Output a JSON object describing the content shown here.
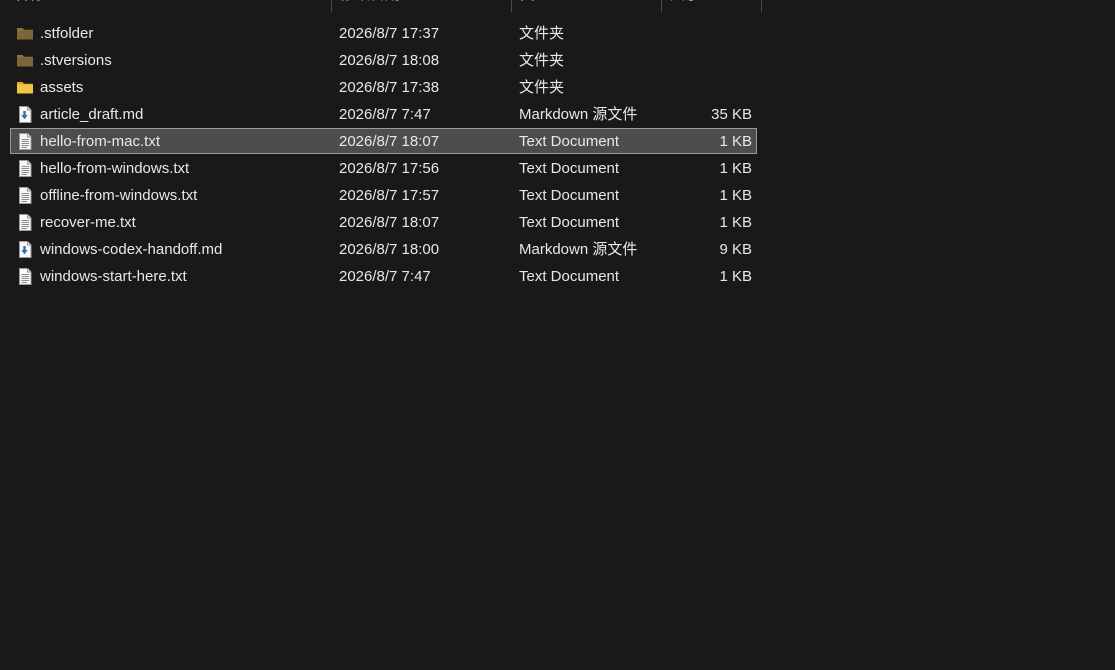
{
  "header": {
    "name_label": "名称",
    "date_label": "修改日期",
    "type_label": "类型",
    "size_label": "大小"
  },
  "files": [
    {
      "name": ".stfolder",
      "date": "2026/8/7 17:37",
      "type": "文件夹",
      "size": "",
      "icon": "folder-dim-icon"
    },
    {
      "name": ".stversions",
      "date": "2026/8/7 18:08",
      "type": "文件夹",
      "size": "",
      "icon": "folder-dim-icon"
    },
    {
      "name": "assets",
      "date": "2026/8/7 17:38",
      "type": "文件夹",
      "size": "",
      "icon": "folder-icon"
    },
    {
      "name": "article_draft.md",
      "date": "2026/8/7 7:47",
      "type": "Markdown 源文件",
      "size": "35 KB",
      "icon": "markdown-file-icon"
    },
    {
      "name": "hello-from-mac.txt",
      "date": "2026/8/7 18:07",
      "type": "Text Document",
      "size": "1 KB",
      "icon": "text-file-icon",
      "selected": true
    },
    {
      "name": "hello-from-windows.txt",
      "date": "2026/8/7 17:56",
      "type": "Text Document",
      "size": "1 KB",
      "icon": "text-file-icon"
    },
    {
      "name": "offline-from-windows.txt",
      "date": "2026/8/7 17:57",
      "type": "Text Document",
      "size": "1 KB",
      "icon": "text-file-icon"
    },
    {
      "name": "recover-me.txt",
      "date": "2026/8/7 18:07",
      "type": "Text Document",
      "size": "1 KB",
      "icon": "text-file-icon"
    },
    {
      "name": "windows-codex-handoff.md",
      "date": "2026/8/7 18:00",
      "type": "Markdown 源文件",
      "size": "9 KB",
      "icon": "markdown-file-icon"
    },
    {
      "name": "windows-start-here.txt",
      "date": "2026/8/7 7:47",
      "type": "Text Document",
      "size": "1 KB",
      "icon": "text-file-icon"
    }
  ],
  "colors": {
    "background": "#191919",
    "selection": "#4d4d4d",
    "folder_dim": "#8c7340",
    "folder": "#f0c040"
  }
}
